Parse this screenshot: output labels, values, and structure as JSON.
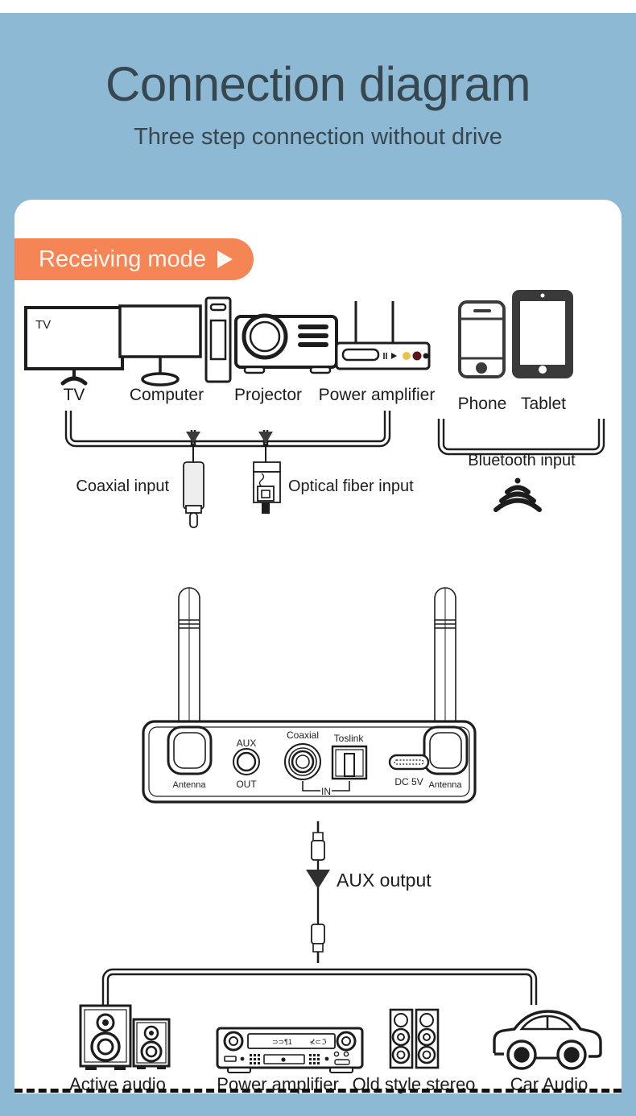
{
  "page": {
    "background_color": "#8db9d4",
    "card_background": "#ffffff",
    "accent_color": "#f58554",
    "line_color": "#1d1d1d"
  },
  "header": {
    "title": "Connection diagram",
    "subtitle": "Three step connection without drive"
  },
  "badge": {
    "label": "Receiving mode",
    "icon": "play-triangle-icon"
  },
  "sources": {
    "wired_devices": [
      {
        "label": "TV",
        "icon": "tv-icon",
        "screen_text": "TV"
      },
      {
        "label": "Computer",
        "icon": "computer-icon"
      },
      {
        "label": "Projector",
        "icon": "projector-icon"
      },
      {
        "label": "Power amplifier",
        "icon": "power-amplifier-icon"
      }
    ],
    "wireless_devices": [
      {
        "label": "Phone",
        "icon": "phone-icon"
      },
      {
        "label": "Tablet",
        "icon": "tablet-icon"
      }
    ],
    "inputs": [
      {
        "label": "Coaxial input",
        "icon": "rca-coaxial-plug-icon"
      },
      {
        "label": "Optical fiber input",
        "icon": "toslink-plug-icon"
      }
    ],
    "bluetooth": {
      "label": "Bluetooth input",
      "icon": "wireless-signal-icon"
    }
  },
  "device": {
    "name": "receiver-unit",
    "antenna_left_label": "Antenna",
    "antenna_right_label": "Antenna",
    "ports": [
      {
        "label_top": "AUX",
        "label_bottom": "OUT",
        "icon": "aux-jack-icon"
      },
      {
        "label_top": "Coaxial",
        "icon": "coaxial-jack-icon"
      },
      {
        "label_top": "Toslink",
        "icon": "toslink-port-icon"
      },
      {
        "label_bottom": "DC 5V",
        "icon": "usb-c-port-icon"
      }
    ],
    "input_group_label": "IN"
  },
  "output": {
    "cable_label": "AUX output",
    "cable_icon": "aux-cable-icon",
    "devices": [
      {
        "label": "Active audio",
        "icon": "bookshelf-speakers-icon"
      },
      {
        "label": "Power amplifier",
        "icon": "stereo-receiver-icon"
      },
      {
        "label": "Old style stereo",
        "icon": "tower-speakers-icon"
      },
      {
        "label": "Car Audio",
        "icon": "car-icon"
      }
    ]
  }
}
